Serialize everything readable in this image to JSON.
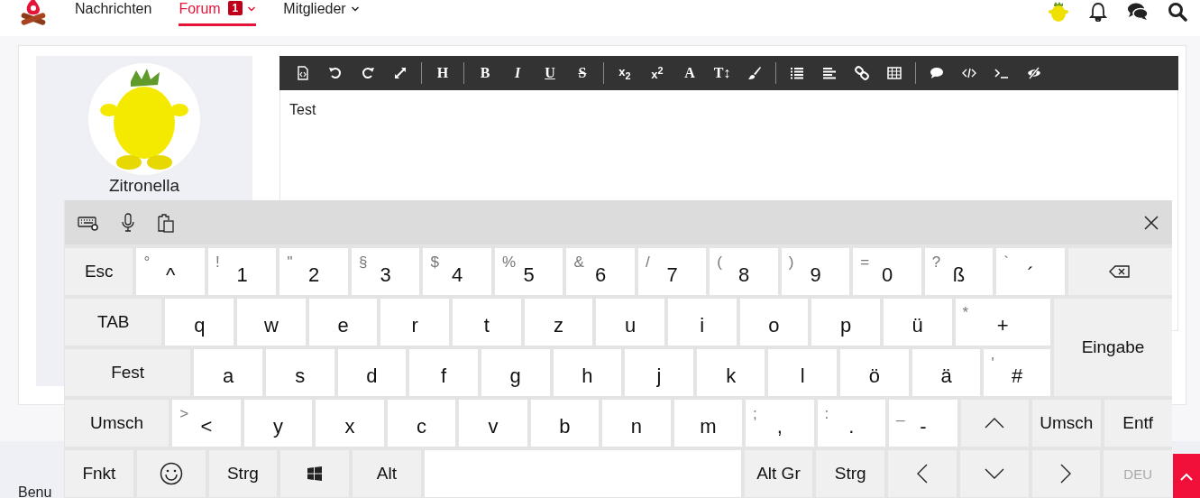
{
  "nav": {
    "items": [
      {
        "label": "Nachrichten",
        "selected": false
      },
      {
        "label": "Forum",
        "selected": true,
        "badge": "1",
        "dropdown": true
      },
      {
        "label": "Mitglieder",
        "selected": false,
        "dropdown": true
      }
    ]
  },
  "profile": {
    "username": "Zitronella"
  },
  "editor": {
    "toolbar": [
      {
        "kind": "source"
      },
      {
        "kind": "undo"
      },
      {
        "kind": "redo"
      },
      {
        "kind": "fullscreen"
      },
      {
        "kind": "separator"
      },
      {
        "kind": "heading",
        "label": "H"
      },
      {
        "kind": "separator"
      },
      {
        "kind": "bold",
        "label": "B"
      },
      {
        "kind": "italic",
        "label": "I"
      },
      {
        "kind": "underline",
        "label": "U"
      },
      {
        "kind": "strike",
        "label": "S"
      },
      {
        "kind": "separator"
      },
      {
        "kind": "subscript",
        "label": "x$_{2}$"
      },
      {
        "kind": "superscript",
        "label": "x$^{2}$"
      },
      {
        "kind": "fontcolor",
        "label": "A"
      },
      {
        "kind": "fontsize",
        "label": "T↕"
      },
      {
        "kind": "brush"
      },
      {
        "kind": "separator"
      },
      {
        "kind": "list"
      },
      {
        "kind": "align"
      },
      {
        "kind": "link"
      },
      {
        "kind": "table"
      },
      {
        "kind": "separator"
      },
      {
        "kind": "comment"
      },
      {
        "kind": "code"
      },
      {
        "kind": "terminal"
      },
      {
        "kind": "preview"
      }
    ],
    "content": "Test"
  },
  "footer": {
    "text": "Benu"
  },
  "keyboard": {
    "rows": [
      {
        "keys": [
          {
            "kind": "func",
            "label": "Esc"
          },
          {
            "kind": "char",
            "main": "^",
            "shift": "°"
          },
          {
            "kind": "char",
            "main": "1",
            "shift": "!"
          },
          {
            "kind": "char",
            "main": "2",
            "shift": "\""
          },
          {
            "kind": "char",
            "main": "3",
            "shift": "§"
          },
          {
            "kind": "char",
            "main": "4",
            "shift": "$"
          },
          {
            "kind": "char",
            "main": "5",
            "shift": "%"
          },
          {
            "kind": "char",
            "main": "6",
            "shift": "&"
          },
          {
            "kind": "char",
            "main": "7",
            "shift": "/"
          },
          {
            "kind": "char",
            "main": "8",
            "shift": "("
          },
          {
            "kind": "char",
            "main": "9",
            "shift": ")"
          },
          {
            "kind": "char",
            "main": "0",
            "shift": "="
          },
          {
            "kind": "char",
            "main": "ß",
            "shift": "?"
          },
          {
            "kind": "char",
            "main": "´",
            "shift": "`"
          },
          {
            "kind": "backspace"
          }
        ]
      },
      {
        "keys": [
          {
            "kind": "func",
            "label": "TAB"
          },
          {
            "kind": "char",
            "main": "q"
          },
          {
            "kind": "char",
            "main": "w"
          },
          {
            "kind": "char",
            "main": "e"
          },
          {
            "kind": "char",
            "main": "r"
          },
          {
            "kind": "char",
            "main": "t"
          },
          {
            "kind": "char",
            "main": "z"
          },
          {
            "kind": "char",
            "main": "u"
          },
          {
            "kind": "char",
            "main": "i"
          },
          {
            "kind": "char",
            "main": "o"
          },
          {
            "kind": "char",
            "main": "p"
          },
          {
            "kind": "char",
            "main": "ü"
          },
          {
            "kind": "char",
            "main": "+",
            "shift": "*"
          }
        ]
      },
      {
        "keys": [
          {
            "kind": "func",
            "label": "Fest"
          },
          {
            "kind": "char",
            "main": "a"
          },
          {
            "kind": "char",
            "main": "s"
          },
          {
            "kind": "char",
            "main": "d"
          },
          {
            "kind": "char",
            "main": "f"
          },
          {
            "kind": "char",
            "main": "g"
          },
          {
            "kind": "char",
            "main": "h"
          },
          {
            "kind": "char",
            "main": "j"
          },
          {
            "kind": "char",
            "main": "k"
          },
          {
            "kind": "char",
            "main": "l"
          },
          {
            "kind": "char",
            "main": "ö"
          },
          {
            "kind": "char",
            "main": "ä"
          },
          {
            "kind": "char",
            "main": "#",
            "shift": "'"
          }
        ]
      },
      {
        "keys": [
          {
            "kind": "func",
            "label": "Umsch"
          },
          {
            "kind": "char",
            "main": "<",
            "shift": ">"
          },
          {
            "kind": "char",
            "main": "y"
          },
          {
            "kind": "char",
            "main": "x"
          },
          {
            "kind": "char",
            "main": "c"
          },
          {
            "kind": "char",
            "main": "v"
          },
          {
            "kind": "char",
            "main": "b"
          },
          {
            "kind": "char",
            "main": "n"
          },
          {
            "kind": "char",
            "main": "m"
          },
          {
            "kind": "char",
            "main": ",",
            "shift": ";"
          },
          {
            "kind": "char",
            "main": ".",
            "shift": ":"
          },
          {
            "kind": "char",
            "main": "-",
            "shift": "_"
          },
          {
            "kind": "up"
          },
          {
            "kind": "func",
            "label": "Umsch"
          },
          {
            "kind": "func",
            "label": "Entf"
          }
        ]
      },
      {
        "keys": [
          {
            "kind": "func",
            "label": "Fnkt"
          },
          {
            "kind": "emoji"
          },
          {
            "kind": "func",
            "label": "Strg"
          },
          {
            "kind": "windows"
          },
          {
            "kind": "func",
            "label": "Alt"
          },
          {
            "kind": "space"
          },
          {
            "kind": "func",
            "label": "Alt Gr"
          },
          {
            "kind": "func",
            "label": "Strg"
          },
          {
            "kind": "left"
          },
          {
            "kind": "down"
          },
          {
            "kind": "right"
          },
          {
            "kind": "func",
            "label": "DEU",
            "disabled": true
          }
        ]
      }
    ],
    "enter": {
      "label": "Eingabe"
    }
  }
}
